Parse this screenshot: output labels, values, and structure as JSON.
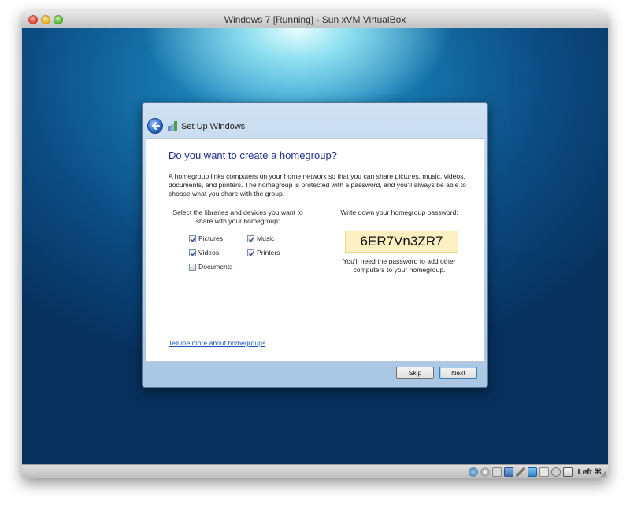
{
  "host_window": {
    "title": "Windows 7 [Running] - Sun xVM VirtualBox"
  },
  "dialog": {
    "title": "Set Up Windows",
    "heading": "Do you want to create a homegroup?",
    "intro": "A homegroup links computers on your home network so that you can share pictures, music, videos, documents, and printers. The homegroup is protected with a password, and you'll always be able to choose what you share with the group.",
    "select_label": "Select the libraries and devices you want to share with your homegroup:",
    "checkboxes": [
      {
        "label": "Pictures",
        "checked": true
      },
      {
        "label": "Music",
        "checked": true
      },
      {
        "label": "Videos",
        "checked": true
      },
      {
        "label": "Printers",
        "checked": true
      },
      {
        "label": "Documents",
        "checked": false
      }
    ],
    "password_label": "Write down your homegroup password:",
    "password": "6ER7Vn3ZR7",
    "password_note": "You'll need the password to add other computers to your homegroup.",
    "help_link": "Tell me more about homegroups",
    "skip_label": "Skip",
    "next_label": "Next"
  },
  "statusbar": {
    "host_key": "Left ⌘",
    "icons": [
      "hard-disk-icon",
      "cd-icon",
      "floppy-icon",
      "network-icon",
      "usb-icon",
      "shared-folder-icon",
      "vrdp-icon",
      "mouse-integration-icon",
      "host-key-icon"
    ]
  },
  "colors": {
    "heading": "#1e3287",
    "link": "#1c58b8",
    "password_bg": "#fcf0c2"
  }
}
